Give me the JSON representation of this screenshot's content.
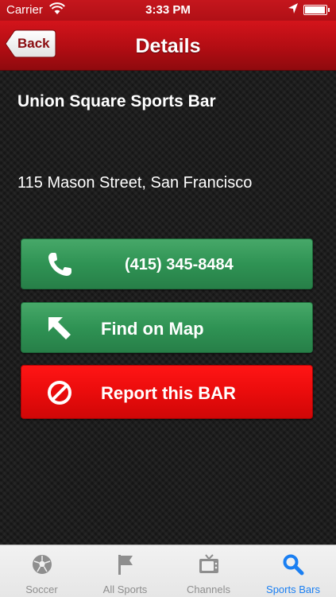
{
  "status_bar": {
    "carrier": "Carrier",
    "time": "3:33 PM",
    "battery_level": 0.95
  },
  "nav": {
    "title": "Details",
    "back_label": "Back"
  },
  "details": {
    "name": "Union Square Sports Bar",
    "address": "115 Mason Street, San Francisco"
  },
  "actions": {
    "phone_label": "(415) 345-8484",
    "map_label": "Find on Map",
    "report_label": "Report this BAR"
  },
  "tabs": [
    {
      "label": "Soccer",
      "icon": "soccer-ball-icon"
    },
    {
      "label": "All Sports",
      "icon": "flag-icon"
    },
    {
      "label": "Channels",
      "icon": "tv-icon"
    },
    {
      "label": "Sports Bars",
      "icon": "search-icon",
      "active": true
    }
  ],
  "colors": {
    "nav_red": "#b20d13",
    "button_green": "#2f9354",
    "button_red": "#ea0c0c",
    "tab_active": "#1a7ff2",
    "tab_inactive": "#8e8e8e"
  }
}
